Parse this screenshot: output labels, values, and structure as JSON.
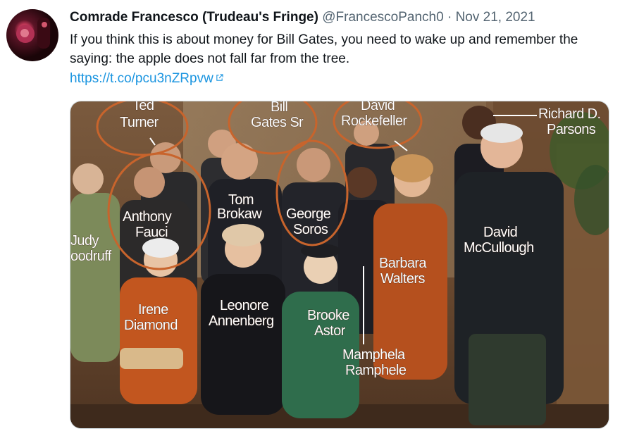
{
  "tweet": {
    "author_name": "Comrade Francesco (Trudeau's Fringe)",
    "handle": "@FrancescoPanch0",
    "separator": "·",
    "date": "Nov 21, 2021",
    "text": "If you think this is about money for Bill Gates, you need to wake up and remember the saying: the apple does not fall far from the tree.",
    "link": "https://t.co/pcu3nZRpvw",
    "link_icon": "external-link-icon"
  },
  "photo": {
    "labels": {
      "ted_turner_1": "Ted",
      "ted_turner_2": "Turner",
      "bill_gates_1": "Bill",
      "bill_gates_2": "Gates Sr",
      "rockefeller_1": "David",
      "rockefeller_2": "Rockefeller",
      "parsons_1": "Richard D.",
      "parsons_2": "Parsons",
      "fauci_1": "Anthony",
      "fauci_2": "Fauci",
      "brokaw_1": "Tom",
      "brokaw_2": "Brokaw",
      "soros_1": "George",
      "soros_2": "Soros",
      "mccullough_1": "David",
      "mccullough_2": "McCullough",
      "woodruff_1": "Judy",
      "woodruff_2": "oodruff",
      "walters_1": "Barbara",
      "walters_2": "Walters",
      "diamond_1": "Irene",
      "diamond_2": "Diamond",
      "annenberg_1": "Leonore",
      "annenberg_2": "Annenberg",
      "astor_1": "Brooke",
      "astor_2": "Astor",
      "ramphele_1": "Mamphela",
      "ramphele_2": "Ramphele"
    },
    "circle_color": "#c8642c"
  }
}
